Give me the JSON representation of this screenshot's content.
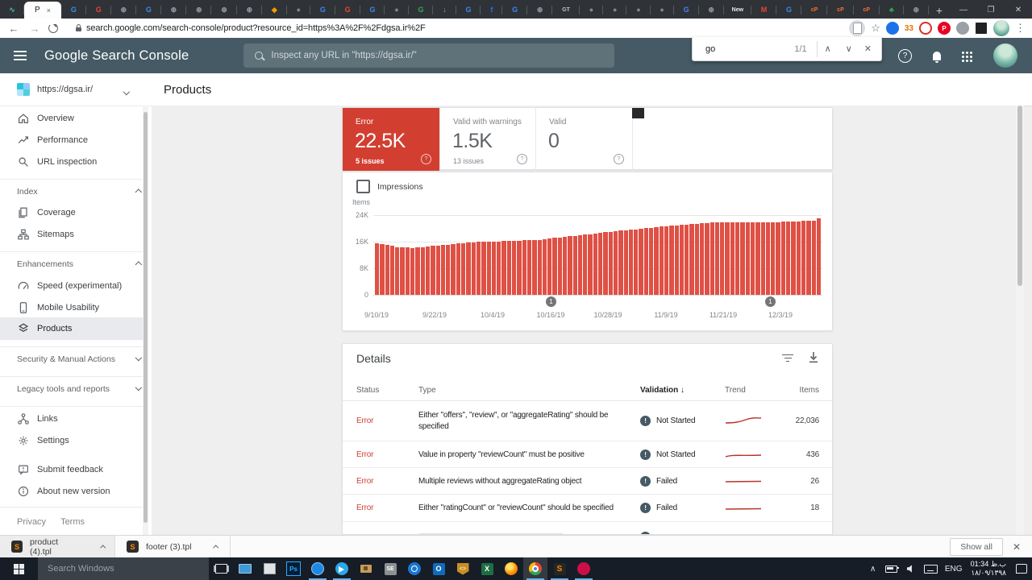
{
  "colors": {
    "error_red": "#d23f31",
    "bar_red": "#df5045",
    "header_bg": "#455a64",
    "selected_item_bg": "#e8eaed",
    "annotation_grey": "#757575",
    "taskbar_bg": "#161d26",
    "underline_blue": "#6cb2e8",
    "download_accent": "#ff8800"
  },
  "browser": {
    "active_tab": {
      "label": "P",
      "close": "×"
    },
    "pinned_tab_glyph": "∿",
    "tab_favicons": [
      {
        "t": "G",
        "c": "#4285f4"
      },
      {
        "t": "G",
        "c": "#ea4335"
      },
      {
        "t": "⊕",
        "c": "#9aa0a6"
      },
      {
        "t": "G",
        "c": "#4285f4"
      },
      {
        "t": "⊕",
        "c": "#9aa0a6"
      },
      {
        "t": "⊕",
        "c": "#9aa0a6"
      },
      {
        "t": "⊕",
        "c": "#9aa0a6"
      },
      {
        "t": "⊕",
        "c": "#9aa0a6"
      },
      {
        "t": "◆",
        "c": "#f29900"
      },
      {
        "t": "●",
        "c": "#80868b"
      },
      {
        "t": "G",
        "c": "#4285f4"
      },
      {
        "t": "G",
        "c": "#ea4335"
      },
      {
        "t": "G",
        "c": "#4285f4"
      },
      {
        "t": "●",
        "c": "#80868b"
      },
      {
        "t": "G",
        "c": "#34a853"
      },
      {
        "t": "↓",
        "c": "#9aa0a6"
      },
      {
        "t": "G",
        "c": "#4285f4"
      },
      {
        "t": "f",
        "c": "#1877f2"
      },
      {
        "t": "G",
        "c": "#4285f4"
      },
      {
        "t": "⊕",
        "c": "#9aa0a6"
      },
      {
        "t": "GT",
        "c": "#bdc1c6"
      },
      {
        "t": "●",
        "c": "#80868b"
      },
      {
        "t": "●",
        "c": "#80868b"
      },
      {
        "t": "●",
        "c": "#80868b"
      },
      {
        "t": "●",
        "c": "#80868b"
      },
      {
        "t": "G",
        "c": "#4285f4"
      },
      {
        "t": "⊕",
        "c": "#9aa0a6"
      },
      {
        "t": "New",
        "c": "#e8eaed"
      },
      {
        "t": "M",
        "c": "#ea4335"
      },
      {
        "t": "G",
        "c": "#4285f4"
      },
      {
        "t": "cP",
        "c": "#ff6c2c"
      },
      {
        "t": "cP",
        "c": "#ff6c2c"
      },
      {
        "t": "cP",
        "c": "#ff6c2c"
      },
      {
        "t": "♣",
        "c": "#34a853"
      },
      {
        "t": "⊕",
        "c": "#9aa0a6"
      }
    ],
    "new_tab_button": "+",
    "window_controls": {
      "minimize": "—",
      "maximize": "❐",
      "close": "✕"
    },
    "back": "←",
    "forward": "→",
    "url": "search.google.com/search-console/product?resource_id=https%3A%2F%2Fdgsa.ir%2F",
    "bookmark_star": "☆",
    "extension_badge_33": "33",
    "extension_pinterest": "P",
    "menu_dots": "⋮",
    "find_bar": {
      "query": "go",
      "count": "1/1",
      "prev": "∧",
      "next": "∨",
      "close": "✕"
    }
  },
  "app_header": {
    "logo": "Google Search Console",
    "search_placeholder": "Inspect any URL in \"https://dgsa.ir/\""
  },
  "sidebar": {
    "property_url": "https://dgsa.ir/",
    "items_top": [
      {
        "label": "Overview"
      },
      {
        "label": "Performance"
      },
      {
        "label": "URL inspection"
      }
    ],
    "sections": [
      {
        "label": "Index",
        "state": "expanded"
      },
      {
        "label": "Enhancements",
        "state": "expanded"
      },
      {
        "label": "Security & Manual Actions",
        "state": "collapsed"
      },
      {
        "label": "Legacy tools and reports",
        "state": "collapsed"
      }
    ],
    "index_items": [
      {
        "label": "Coverage"
      },
      {
        "label": "Sitemaps"
      }
    ],
    "enhancement_items": [
      {
        "label": "Speed (experimental)"
      },
      {
        "label": "Mobile Usability"
      },
      {
        "label": "Products",
        "selected": true
      }
    ],
    "items_bottom": [
      {
        "label": "Links"
      },
      {
        "label": "Settings"
      }
    ],
    "items_meta": [
      {
        "label": "Submit feedback"
      },
      {
        "label": "About new version"
      }
    ],
    "footer": {
      "privacy": "Privacy",
      "terms": "Terms"
    }
  },
  "page": {
    "title": "Products"
  },
  "summary_cards": [
    {
      "label": "Error",
      "value": "22.5K",
      "issues": "5 issues",
      "selected": true
    },
    {
      "label": "Valid with warnings",
      "value": "1.5K",
      "issues": "13 issues"
    },
    {
      "label": "Valid",
      "value": "0",
      "issues": ""
    }
  ],
  "chart": {
    "toggle_label": "Impressions",
    "y_axis_label": "Items",
    "y_ticks": [
      "24K",
      "16K",
      "8K",
      "0"
    ],
    "x_ticks": [
      "9/10/19",
      "9/22/19",
      "10/4/19",
      "10/16/19",
      "10/28/19",
      "11/9/19",
      "11/21/19",
      "12/3/19"
    ],
    "annotation_label": "1"
  },
  "chart_data": {
    "type": "bar",
    "title": "Products — valid and error items over time",
    "ylabel": "Items",
    "ylim": [
      0,
      24000
    ],
    "x_ticks": [
      "9/10/19",
      "9/22/19",
      "10/4/19",
      "10/16/19",
      "10/28/19",
      "11/9/19",
      "11/21/19",
      "12/3/19"
    ],
    "annotations": [
      {
        "label": "1",
        "near": "10/16/19"
      },
      {
        "label": "1",
        "near": "12/3/19"
      }
    ],
    "values": [
      15500,
      15300,
      15100,
      14900,
      14400,
      14300,
      14200,
      14100,
      14300,
      14400,
      14600,
      14700,
      14800,
      15000,
      15100,
      15300,
      15400,
      15500,
      15700,
      15800,
      15900,
      16000,
      16000,
      16100,
      16100,
      16200,
      16200,
      16300,
      16300,
      16400,
      16400,
      16500,
      16600,
      16800,
      17000,
      17100,
      17300,
      17400,
      17600,
      17800,
      18000,
      18100,
      18300,
      18500,
      18600,
      18800,
      19000,
      19100,
      19300,
      19400,
      19600,
      19700,
      19900,
      20000,
      20200,
      20300,
      20500,
      20600,
      20800,
      20900,
      21000,
      21200,
      21300,
      21400,
      21500,
      21600,
      21700,
      21700,
      21800,
      21800,
      21900,
      21900,
      21800,
      21800,
      21700,
      21700,
      21800,
      21800,
      21900,
      21900,
      22000,
      22000,
      22100,
      22100,
      22200,
      22200,
      22300,
      23000
    ]
  },
  "details": {
    "title": "Details",
    "columns": {
      "status": "Status",
      "type": "Type",
      "validation": "Validation",
      "sort_arrow": "↓",
      "trend": "Trend",
      "items": "Items"
    },
    "rows": [
      {
        "status": "Error",
        "type": "Either \"offers\", \"review\", or \"aggregateRating\" should be specified",
        "validation": "Not Started",
        "items": "22,036"
      },
      {
        "status": "Error",
        "type": "Value in property \"reviewCount\" must be positive",
        "validation": "Not Started",
        "items": "436"
      },
      {
        "status": "Error",
        "type": "Multiple reviews without aggregateRating object",
        "validation": "Failed",
        "items": "26"
      },
      {
        "status": "Error",
        "type": "Either \"ratingCount\" or \"reviewCount\" should be specified",
        "validation": "Failed",
        "items": "18"
      }
    ],
    "validation_icon_glyph": "!"
  },
  "downloads": {
    "items": [
      {
        "name": "product (4).tpl"
      },
      {
        "name": "footer (3).tpl"
      }
    ],
    "file_icon_letter": "S",
    "show_all": "Show all",
    "close": "✕"
  },
  "taskbar": {
    "search_placeholder": "Search Windows",
    "language": "ENG",
    "time": "01:34 ب.ظ",
    "date": "۱۸/۰۹/۱۳۹۸"
  }
}
